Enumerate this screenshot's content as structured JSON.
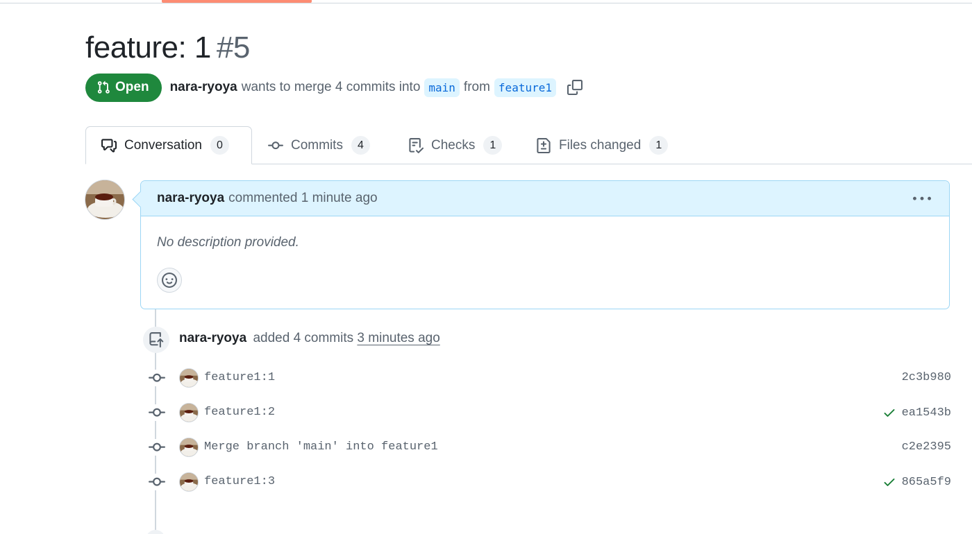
{
  "pr": {
    "title": "feature: 1",
    "number": "#5",
    "state": "Open",
    "author": "nara-ryoya",
    "merge_text": "wants to merge 4 commits into",
    "base_branch": "main",
    "from_text": "from",
    "head_branch": "feature1"
  },
  "tabs": [
    {
      "label": "Conversation",
      "count": "0",
      "icon": "comment-discussion-icon"
    },
    {
      "label": "Commits",
      "count": "4",
      "icon": "git-commit-icon"
    },
    {
      "label": "Checks",
      "count": "1",
      "icon": "checklist-icon"
    },
    {
      "label": "Files changed",
      "count": "1",
      "icon": "file-diff-icon"
    }
  ],
  "comment": {
    "author": "nara-ryoya",
    "action": "commented 1 minute ago",
    "body": "No description provided."
  },
  "event": {
    "author": "nara-ryoya",
    "action": "added 4 commits",
    "time": "3 minutes ago"
  },
  "commits": [
    {
      "message": "feature1:1",
      "sha": "2c3b980",
      "verified": false
    },
    {
      "message": "feature1:2",
      "sha": "ea1543b",
      "verified": true
    },
    {
      "message": "Merge branch 'main' into feature1",
      "sha": "c2e2395",
      "verified": false
    },
    {
      "message": "feature1:3",
      "sha": "865a5f9",
      "verified": true
    }
  ],
  "colors": {
    "open_green": "#1f883d",
    "branch_blue": "#0969da",
    "comment_header_bg": "#ddf4ff",
    "tab_accent": "#fd8c73",
    "check_green": "#1a7f37"
  }
}
